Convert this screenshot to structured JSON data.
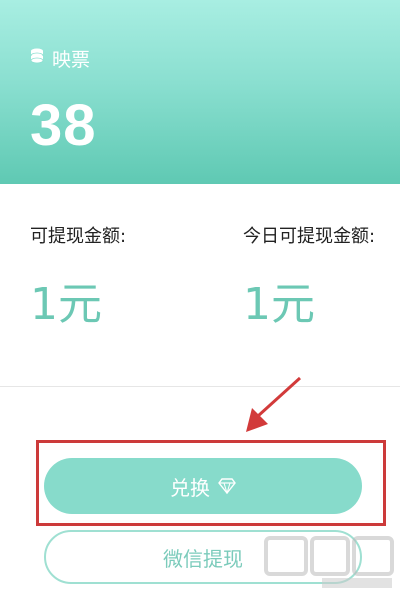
{
  "balance": {
    "label": "映票",
    "value": "38"
  },
  "withdraw": {
    "available_label": "可提现金额:",
    "available_value": "1元",
    "today_label": "今日可提现金额:",
    "today_value": "1元"
  },
  "buttons": {
    "exchange": "兑换",
    "wechat_withdraw": "微信提现"
  },
  "colors": {
    "accent": "#6cc8b4",
    "button": "#87dbcb",
    "highlight": "#cc3a3a"
  },
  "icons": {
    "balance": "coin-stack-icon",
    "exchange": "diamond-icon"
  }
}
